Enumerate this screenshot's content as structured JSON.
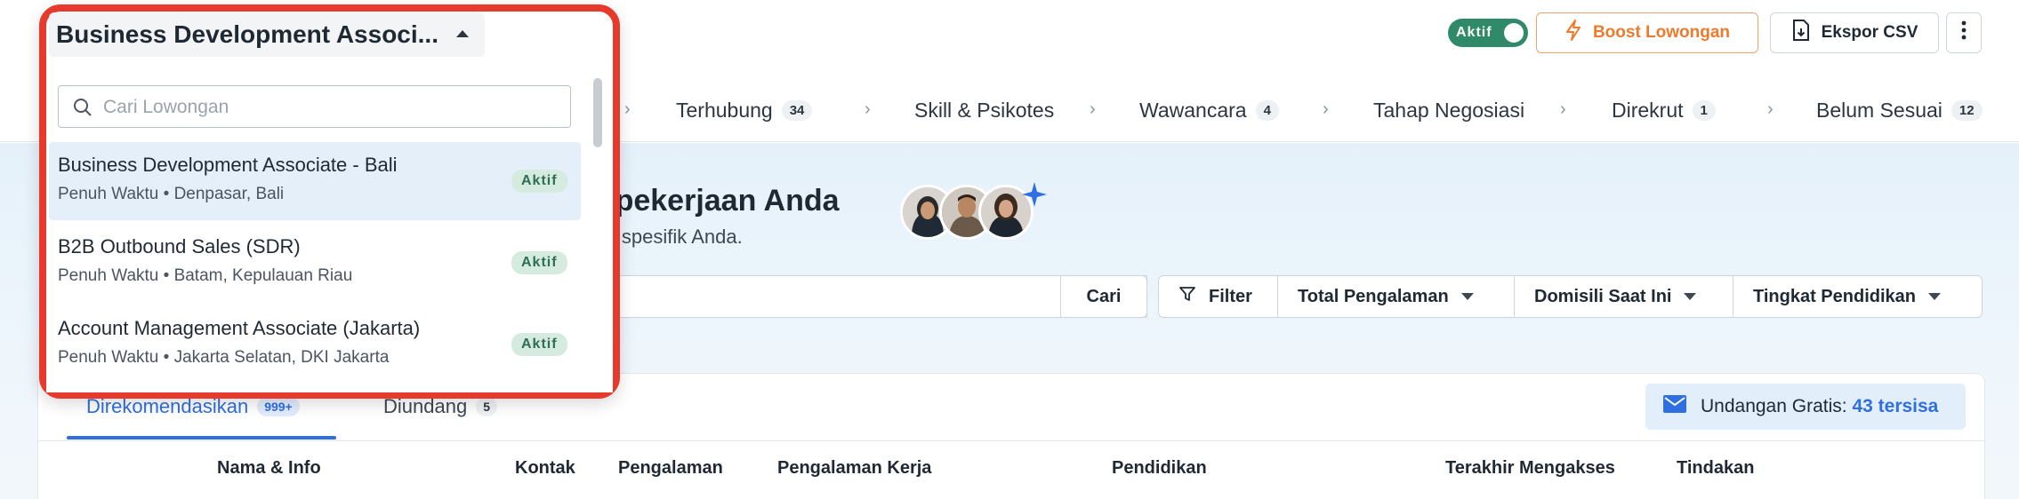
{
  "header": {
    "job_selector": "Business Development Associ...",
    "status_toggle": "Aktif",
    "boost_label": "Boost Lowongan",
    "export_label": "Ekspor CSV"
  },
  "stages": [
    {
      "label": "Terhubung",
      "count": "34"
    },
    {
      "label": "Skill & Psikotes",
      "count": ""
    },
    {
      "label": "Wawancara",
      "count": "4"
    },
    {
      "label": "Tahap Negosiasi",
      "count": ""
    },
    {
      "label": "Direkrut",
      "count": "1"
    },
    {
      "label": "Belum Sesuai",
      "count": "12"
    }
  ],
  "hero": {
    "title_partial": "ar pekerjaan Anda",
    "subtitle_partial": "atan spesifik Anda."
  },
  "filters": {
    "search_button": "Cari",
    "filter_label": "Filter",
    "experience_label": "Total Pengalaman",
    "domicile_label": "Domisili Saat Ini",
    "education_label": "Tingkat Pendidikan"
  },
  "tabs": {
    "recommended_label": "Direkomendasikan",
    "recommended_count": "999+",
    "invited_label": "Diundang",
    "invited_count": "5"
  },
  "invite": {
    "label": "Undangan Gratis:",
    "remaining": "43 tersisa"
  },
  "columns": [
    "Nama & Info",
    "Kontak",
    "Pengalaman",
    "Pengalaman Kerja",
    "Pendidikan",
    "Terakhir Mengakses",
    "Tindakan"
  ],
  "dropdown": {
    "search_placeholder": "Cari Lowongan",
    "items": [
      {
        "title": "Business Development Associate - Bali",
        "subtitle": "Penuh Waktu • Denpasar, Bali",
        "badge": "Aktif"
      },
      {
        "title": "B2B Outbound Sales (SDR)",
        "subtitle": "Penuh Waktu • Batam, Kepulauan Riau",
        "badge": "Aktif"
      },
      {
        "title": "Account Management Associate (Jakarta)",
        "subtitle": "Penuh Waktu • Jakarta Selatan, DKI Jakarta",
        "badge": "Aktif"
      }
    ]
  },
  "colors": {
    "accent": "#2f6fe0",
    "active_green": "#2e8a68",
    "boost_orange": "#ef7a2c",
    "highlight_red": "#e53a2c"
  }
}
